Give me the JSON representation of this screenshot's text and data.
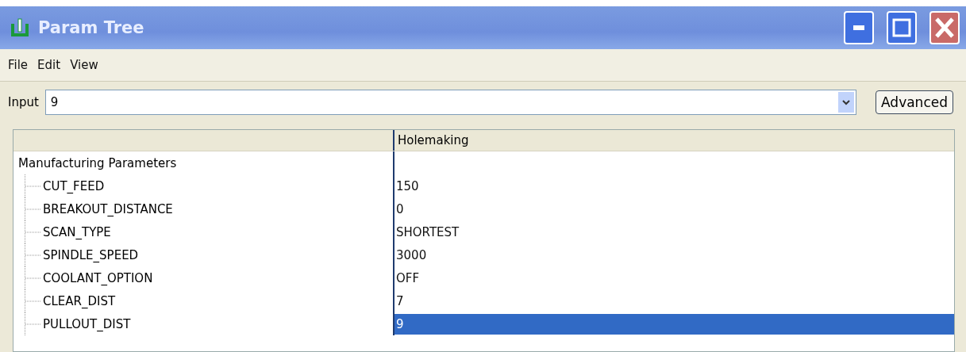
{
  "window": {
    "title": "Param Tree"
  },
  "menu": [
    "File",
    "Edit",
    "View"
  ],
  "input": {
    "label": "Input",
    "value": "9"
  },
  "buttons": [
    "Advanced"
  ],
  "table": {
    "columns": [
      "Holemaking"
    ],
    "tree": {
      "label": "Manufacturing Parameters",
      "children": [
        {
          "label": "CUT_FEED",
          "value": "150",
          "selected": false
        },
        {
          "label": "BREAKOUT_DISTANCE",
          "value": "0",
          "selected": false
        },
        {
          "label": "SCAN_TYPE",
          "value": "SHORTEST",
          "selected": false
        },
        {
          "label": "SPINDLE_SPEED",
          "value": "3000",
          "selected": false
        },
        {
          "label": "COOLANT_OPTION",
          "value": "OFF",
          "selected": false
        },
        {
          "label": "CLEAR_DIST",
          "value": "7",
          "selected": false
        },
        {
          "label": "PULLOUT_DIST",
          "value": "9",
          "selected": true
        }
      ]
    }
  }
}
